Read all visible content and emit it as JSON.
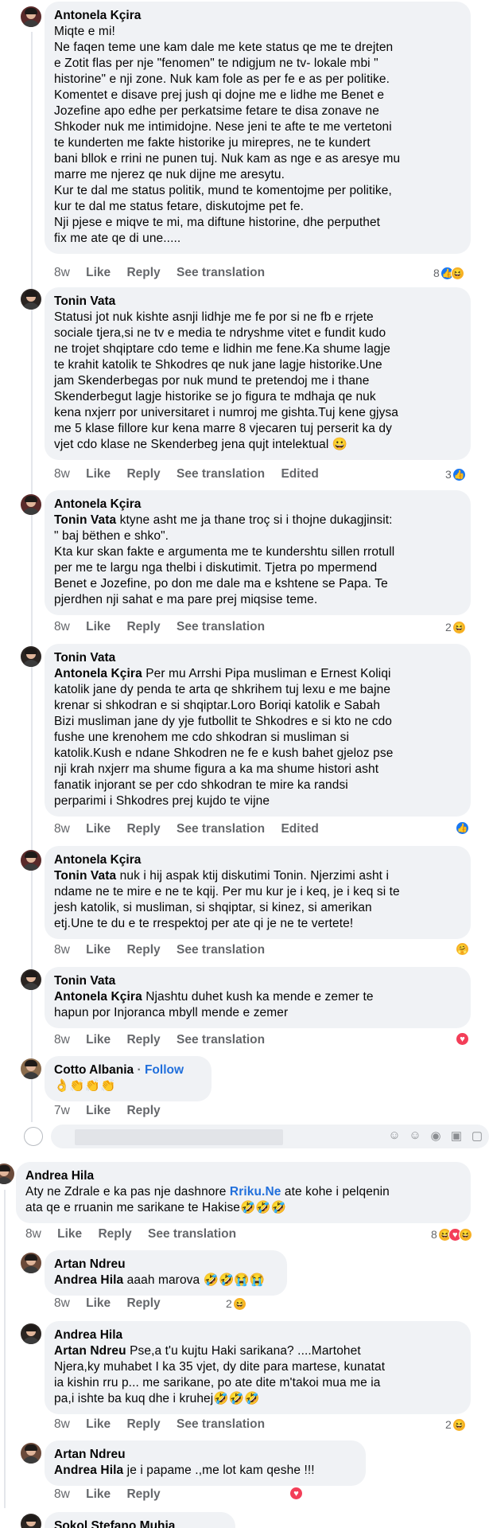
{
  "comments": [
    {
      "author": "Antonela Kçira",
      "text": "Miqte e mi!\nNe faqen teme une kam dale me kete status qe me te drejten\ne Zotit flas per nje \"fenomen\" te ndigjum ne tv- lokale mbi \"\nhistorine\" e nji zone. Nuk kam fole as per fe e as per politike.\nKomentet e disave prej jush qi dojne me e lidhe me Benet e\nJozefine apo edhe per perkatsime fetare te disa zonave ne\nShkoder nuk me intimidojne. Nese jeni te afte te me vertetoni\nte kunderten me fakte historike ju mirepres, ne te kundert\nbani bllok e rrini ne punen tuj. Nuk kam as nge e as aresye mu\nmarre me njerez qe nuk dijne me aresytu.\nKur te dal me status politik, mund te komentojme per politike,\nkur te dal me status fetare, diskutojme pet fe.\nNji pjese e miqve te mi, ma diftune historine, dhe perputhet\nfix me ate qe di une.....",
      "time": "8w",
      "like": "Like",
      "reply": "Reply",
      "see_translation": "See translation",
      "reaction_count": "8"
    },
    {
      "author": "Tonin Vata",
      "text": "Statusi jot nuk kishte asnji lidhje me fe por si ne fb e rrjete\nsociale tjera,si ne tv e media te ndryshme vitet e fundit kudo\nne trojet shqiptare cdo teme e lidhin me fene.Ka shume lagje\nte krahit katolik te Shkodres qe nuk jane lagje historike.Une\njam Skenderbegas por nuk mund te pretendoj me i thane\nSkenderbegut lagje historike se jo figura te mdhaja qe nuk\nkena nxjerr por universitaret i numroj me gishta.Tuj kene gjysa\nme 5 klase fillore kur kena marre 8 vjecaren tuj perserit ka dy\nvjet cdo klase ne Skenderbeg jena qujt intelektual 😀",
      "time": "8w",
      "like": "Like",
      "reply": "Reply",
      "see_translation": "See translation",
      "edited": "Edited",
      "reaction_count": "3"
    },
    {
      "author": "Antonela Kçira",
      "mention": "Tonin Vata",
      "text": " ktyne asht me ja thane troç si i thojne dukagjinsit:\n\" baj bëthen e shko\".\nKta kur skan fakte e argumenta me te kundershtu sillen rrotull\nper me te largu nga thelbi i diskutimit. Tjetra po mpermend\nBenet e Jozefine, po don me dale ma e kshtene se Papa. Te\npjerdhen nji sahat e ma pare prej miqsise teme.",
      "time": "8w",
      "like": "Like",
      "reply": "Reply",
      "see_translation": "See translation",
      "reaction_count": "2"
    },
    {
      "author": "Tonin Vata",
      "mention": "Antonela Kçira",
      "text": " Per mu Arrshi Pipa musliman e Ernest Koliqi\nkatolik jane dy penda te arta qe shkrihem tuj lexu e me bajne\nkrenar si shkodran e si shqiptar.Loro Boriqi katolik e Sabah\nBizi musliman jane dy yje futbollit te Shkodres e si kto ne cdo\nfushe une krenohem me cdo shkodran si musliman si\nkatolik.Kush e ndane Shkodren ne fe e kush bahet gjeloz pse\nnji krah nxjerr ma shume figura a ka ma shume histori asht\nfanatik injorant se per cdo shkodran te mire ka randsi\nperparimi i Shkodres prej kujdo te vijne",
      "time": "8w",
      "like": "Like",
      "reply": "Reply",
      "see_translation": "See translation",
      "edited": "Edited"
    },
    {
      "author": "Antonela Kçira",
      "mention": "Tonin Vata",
      "text": " nuk i hij aspak ktij diskutimi Tonin. Njerzimi asht i\nndame ne te mire e ne te kqij. Per mu kur je i keq, je i keq si te\njesh katolik, si musliman, si shqiptar, si kinez, si amerikan\netj.Une te du e te rrespektoj per ate qi je ne te vertete!",
      "time": "8w",
      "like": "Like",
      "reply": "Reply",
      "see_translation": "See translation"
    },
    {
      "author": "Tonin Vata",
      "mention": "Antonela Kçira",
      "text": " Njashtu duhet kush ka mende e zemer te\nhapun por Injoranca mbyll mende e zemer",
      "time": "8w",
      "like": "Like",
      "reply": "Reply",
      "see_translation": "See translation"
    },
    {
      "author": "Cotto Albania",
      "separator": "·",
      "follow": "Follow",
      "text": "👌👏👏👏",
      "time": "7w",
      "like": "Like",
      "reply": "Reply"
    },
    {
      "author": "Andrea Hila",
      "text_a": "Aty ne Zdrale e ka pas nje dashnore ",
      "link": "Rriku.Ne",
      "text_b": " ate kohe i pelqenin\nata qe e rruanin me sarikane te Hakise🤣🤣🤣",
      "time": "8w",
      "like": "Like",
      "reply": "Reply",
      "see_translation": "See translation",
      "reaction_count": "8"
    },
    {
      "author": "Artan Ndreu",
      "mention": "Andrea Hila",
      "text": " aaah marova 🤣🤣😭😭",
      "time": "8w",
      "like": "Like",
      "reply": "Reply",
      "reaction_count": "2"
    },
    {
      "author": "Andrea Hila",
      "mention": "Artan Ndreu",
      "text": " Pse,a t'u kujtu Haki sarikana? ....Martohet\nNjera,ky muhabet I ka 35 vjet, dy dite para martese, kunatat\nia kishin rru p... me sarikane, po ate dite m'takoi mua me ia\npa,i ishte ba kuq dhe i kruhej🤣🤣🤣",
      "time": "8w",
      "like": "Like",
      "reply": "Reply",
      "see_translation": "See translation",
      "reaction_count": "2"
    },
    {
      "author": "Artan Ndreu",
      "mention": "Andrea Hila",
      "text": " je i papame .,me lot kam qeshe !!!",
      "time": "8w",
      "like": "Like",
      "reply": "Reply"
    },
    {
      "author": "Sokol Stefano Muhja"
    }
  ],
  "colors": {
    "like_blue": "#1877f2",
    "link_blue": "#216fdb",
    "meta_gray": "#65676b",
    "bubble_bg": "#f0f2f5"
  },
  "reply_box": {
    "icons": [
      "gif-face-icon",
      "emoji-icon",
      "camera-icon",
      "gif-icon",
      "sticker-icon"
    ]
  },
  "icon_glyphs": {
    "like": "👍",
    "haha": "😆",
    "love": "♥",
    "care": "🤗"
  }
}
